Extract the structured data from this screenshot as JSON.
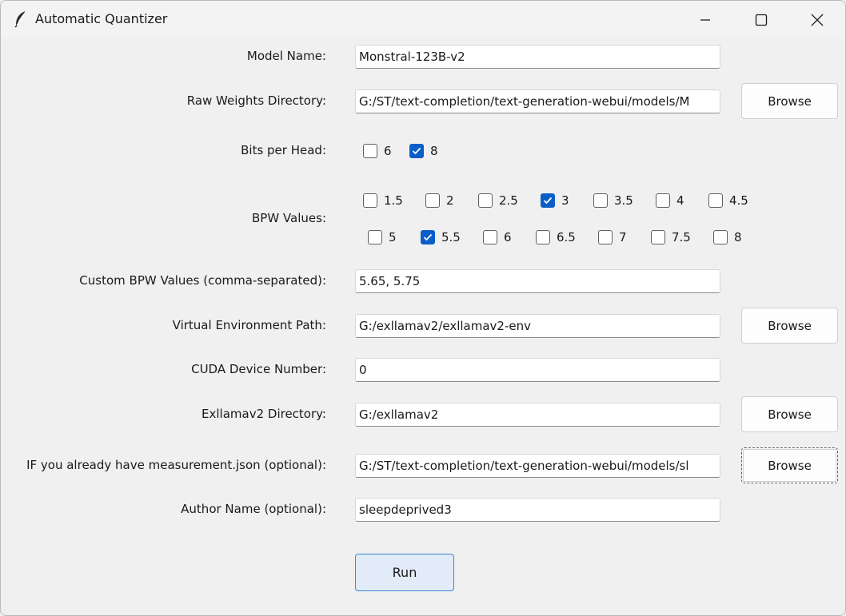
{
  "window": {
    "title": "Automatic Quantizer",
    "icon": "feather-icon",
    "controls": [
      "minimize-icon",
      "maximize-icon",
      "close-icon"
    ]
  },
  "form": {
    "model_name": {
      "label": "Model Name:",
      "value": "Monstral-123B-v2"
    },
    "raw_weights_dir": {
      "label": "Raw Weights Directory:",
      "value": "G:/ST/text-completion/text-generation-webui/models/M",
      "button": "Browse"
    },
    "bits_per_head": {
      "label": "Bits per Head:",
      "options": [
        {
          "label": "6",
          "checked": false
        },
        {
          "label": "8",
          "checked": true
        }
      ]
    },
    "bpw_values": {
      "label": "BPW Values:",
      "row1": [
        {
          "label": "1.5",
          "checked": false
        },
        {
          "label": "2",
          "checked": false
        },
        {
          "label": "2.5",
          "checked": false
        },
        {
          "label": "3",
          "checked": true
        },
        {
          "label": "3.5",
          "checked": false
        },
        {
          "label": "4",
          "checked": false
        },
        {
          "label": "4.5",
          "checked": false
        }
      ],
      "row2": [
        {
          "label": "5",
          "checked": false
        },
        {
          "label": "5.5",
          "checked": true
        },
        {
          "label": "6",
          "checked": false
        },
        {
          "label": "6.5",
          "checked": false
        },
        {
          "label": "7",
          "checked": false
        },
        {
          "label": "7.5",
          "checked": false
        },
        {
          "label": "8",
          "checked": false
        }
      ]
    },
    "custom_bpw": {
      "label": "Custom BPW Values (comma-separated):",
      "value": "5.65, 5.75"
    },
    "venv_path": {
      "label": "Virtual Environment Path:",
      "value": "G:/exllamav2/exllamav2-env",
      "button": "Browse"
    },
    "cuda_device": {
      "label": "CUDA Device Number:",
      "value": "0"
    },
    "exllamav2_dir": {
      "label": "Exllamav2 Directory:",
      "value": "G:/exllamav2",
      "button": "Browse"
    },
    "measurement_json": {
      "label": "IF you already have measurement.json (optional):",
      "value": "G:/ST/text-completion/text-generation-webui/models/sl",
      "button": "Browse"
    },
    "author_name": {
      "label": "Author Name (optional):",
      "value": "sleepdeprived3"
    },
    "run_button": "Run"
  },
  "colors": {
    "accent": "#0a5ec8",
    "run_bg": "#e1ecf8",
    "run_border": "#3d86d6"
  }
}
